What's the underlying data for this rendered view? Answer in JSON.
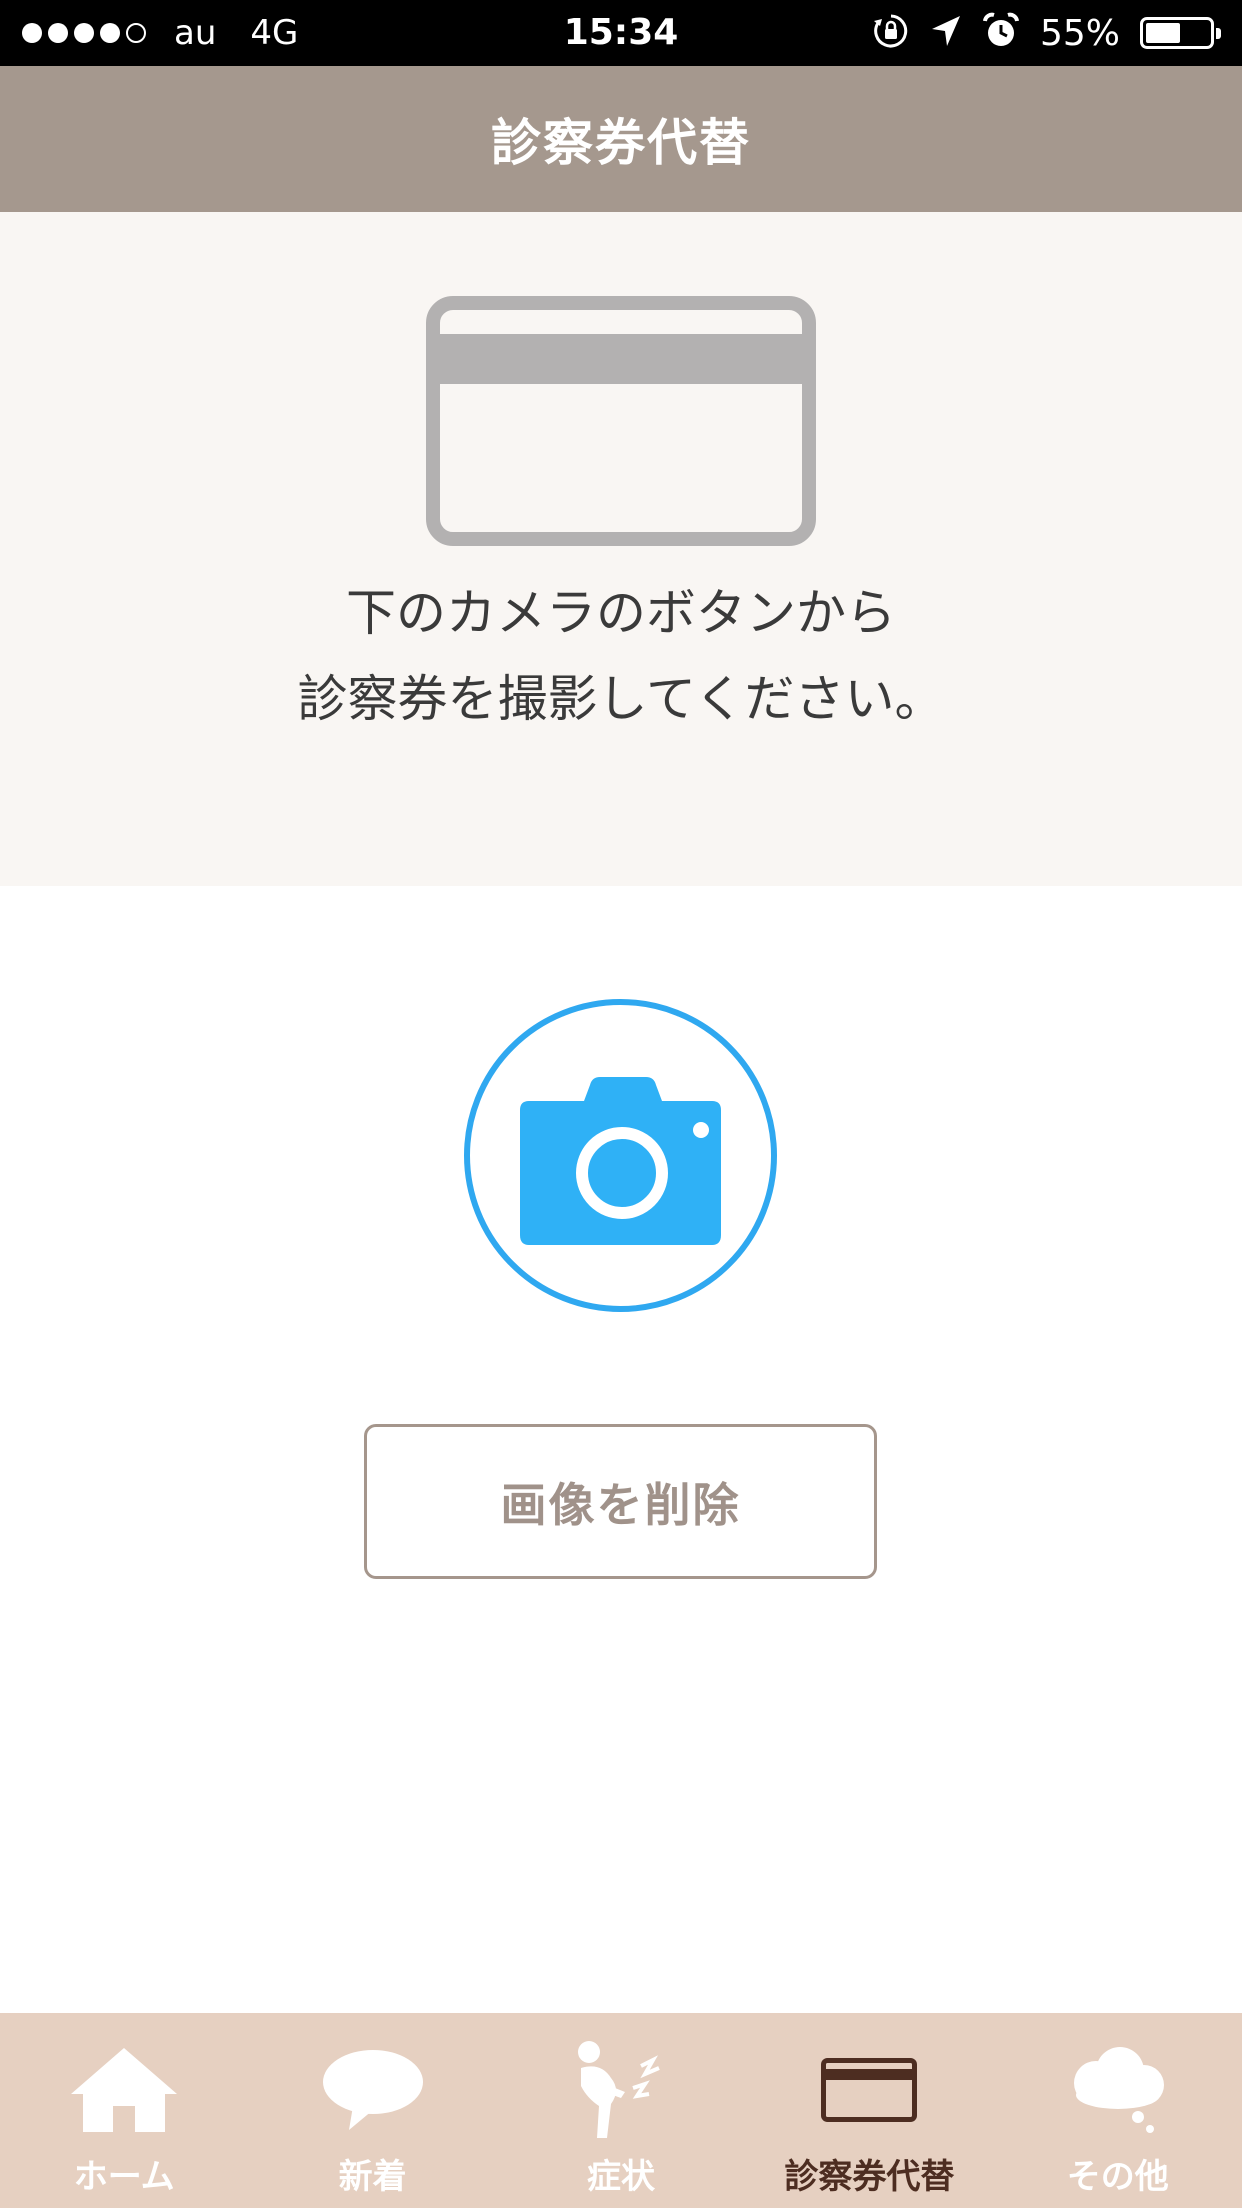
{
  "status_bar": {
    "signal_filled": 4,
    "signal_total": 5,
    "carrier": "au",
    "network": "4G",
    "time": "15:34",
    "icons": [
      "orientation-lock-icon",
      "location-arrow-icon",
      "alarm-icon"
    ],
    "battery_percent_text": "55%",
    "battery_level": 0.55
  },
  "nav": {
    "title": "診察券代替"
  },
  "instruction": {
    "line1": "下のカメラのボタンから",
    "line2": "診察券を撮影してください。",
    "illustration": "card-icon"
  },
  "camera": {
    "icon": "camera-icon",
    "accent_color": "#2fa8f0"
  },
  "delete_button": {
    "label": "画像を削除"
  },
  "tabs": [
    {
      "label": "ホーム",
      "icon": "home-icon",
      "active": false
    },
    {
      "label": "新着",
      "icon": "speech-bubble-icon",
      "active": false
    },
    {
      "label": "症状",
      "icon": "symptom-person-icon",
      "active": false
    },
    {
      "label": "診察券代替",
      "icon": "card-icon",
      "active": true
    },
    {
      "label": "その他",
      "icon": "cloud-icon",
      "active": false
    }
  ],
  "colors": {
    "nav_bar": "#a5988e",
    "tab_bar": "#e6d0c1",
    "tab_active_label": "#4d2d21",
    "instruction_bg": "#f9f6f3"
  }
}
